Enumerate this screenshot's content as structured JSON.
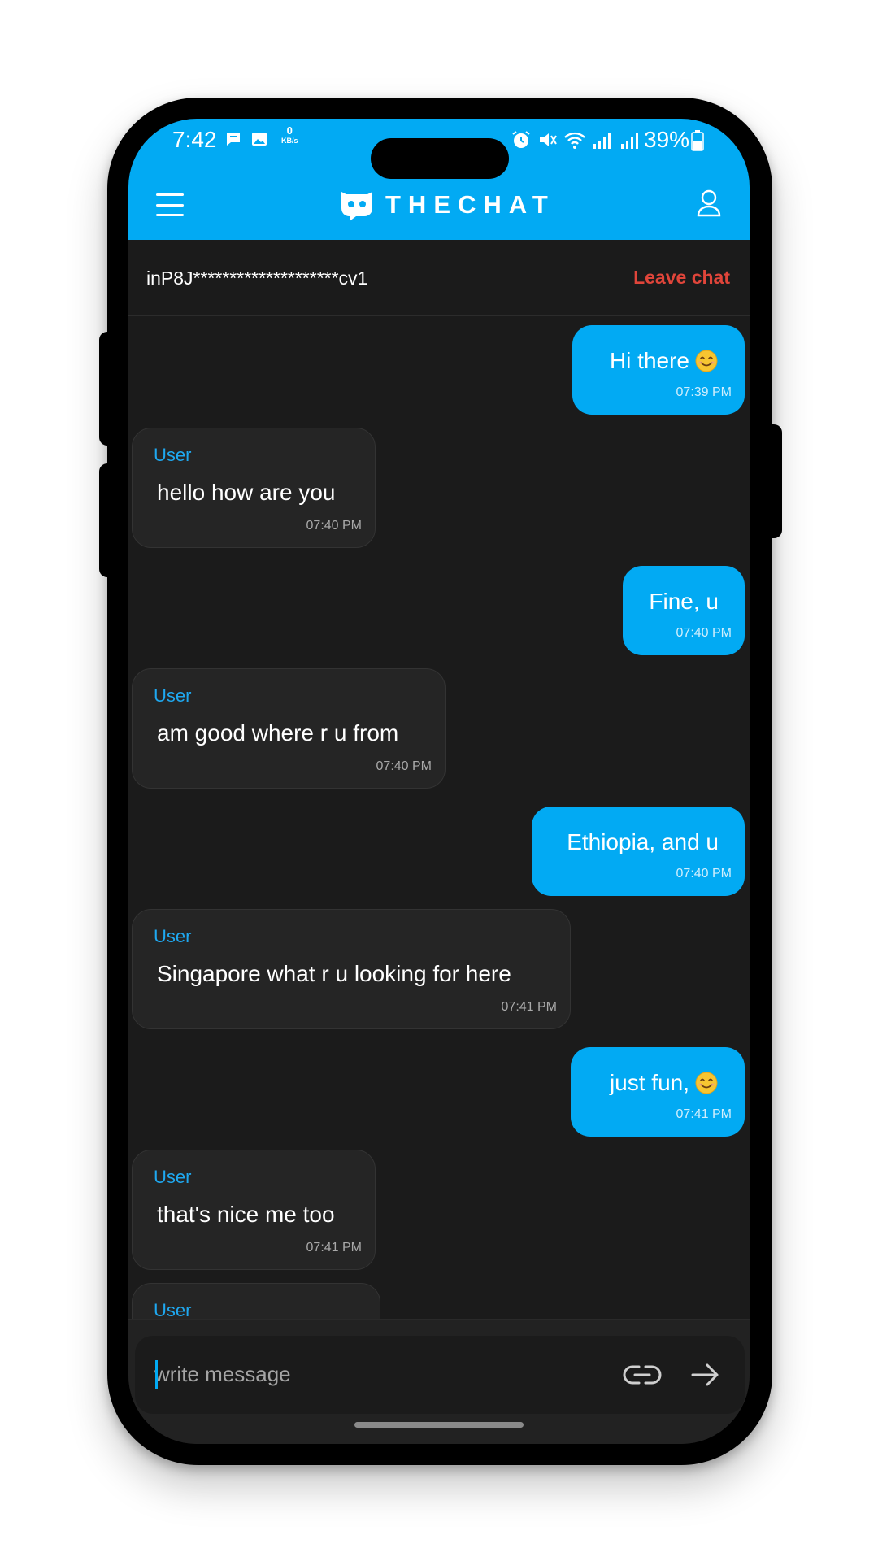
{
  "status_bar": {
    "time": "7:42",
    "network_speed": "0",
    "network_unit": "KB/s",
    "battery": "39%"
  },
  "header": {
    "brand": "THECHAT"
  },
  "session": {
    "id": "inP8J********************cv1",
    "leave_label": "Leave chat"
  },
  "messages": [
    {
      "direction": "out",
      "text": "Hi there",
      "time": "07:39 PM",
      "emoji": "smiling-face"
    },
    {
      "direction": "in",
      "sender": "User",
      "text": "hello how are you",
      "time": "07:40 PM"
    },
    {
      "direction": "out",
      "text": "Fine, u",
      "time": "07:40 PM"
    },
    {
      "direction": "in",
      "sender": "User",
      "text": "am good where r u from",
      "time": "07:40 PM"
    },
    {
      "direction": "out",
      "text": "Ethiopia, and u",
      "time": "07:40 PM"
    },
    {
      "direction": "in",
      "sender": "User",
      "text": "Singapore what r u looking for here",
      "time": "07:41 PM"
    },
    {
      "direction": "out",
      "text": "just fun,",
      "time": "07:41 PM",
      "emoji": "smiling-face"
    },
    {
      "direction": "in",
      "sender": "User",
      "text": "that's nice me too",
      "time": "07:41 PM"
    },
    {
      "direction": "in",
      "sender": "User",
      "text": "",
      "time": ""
    }
  ],
  "composer": {
    "placeholder": "write message"
  },
  "colors": {
    "accent": "#02aaf3",
    "background": "#1b1b1b",
    "incoming_bubble": "#252525",
    "leave": "#e0453a"
  }
}
